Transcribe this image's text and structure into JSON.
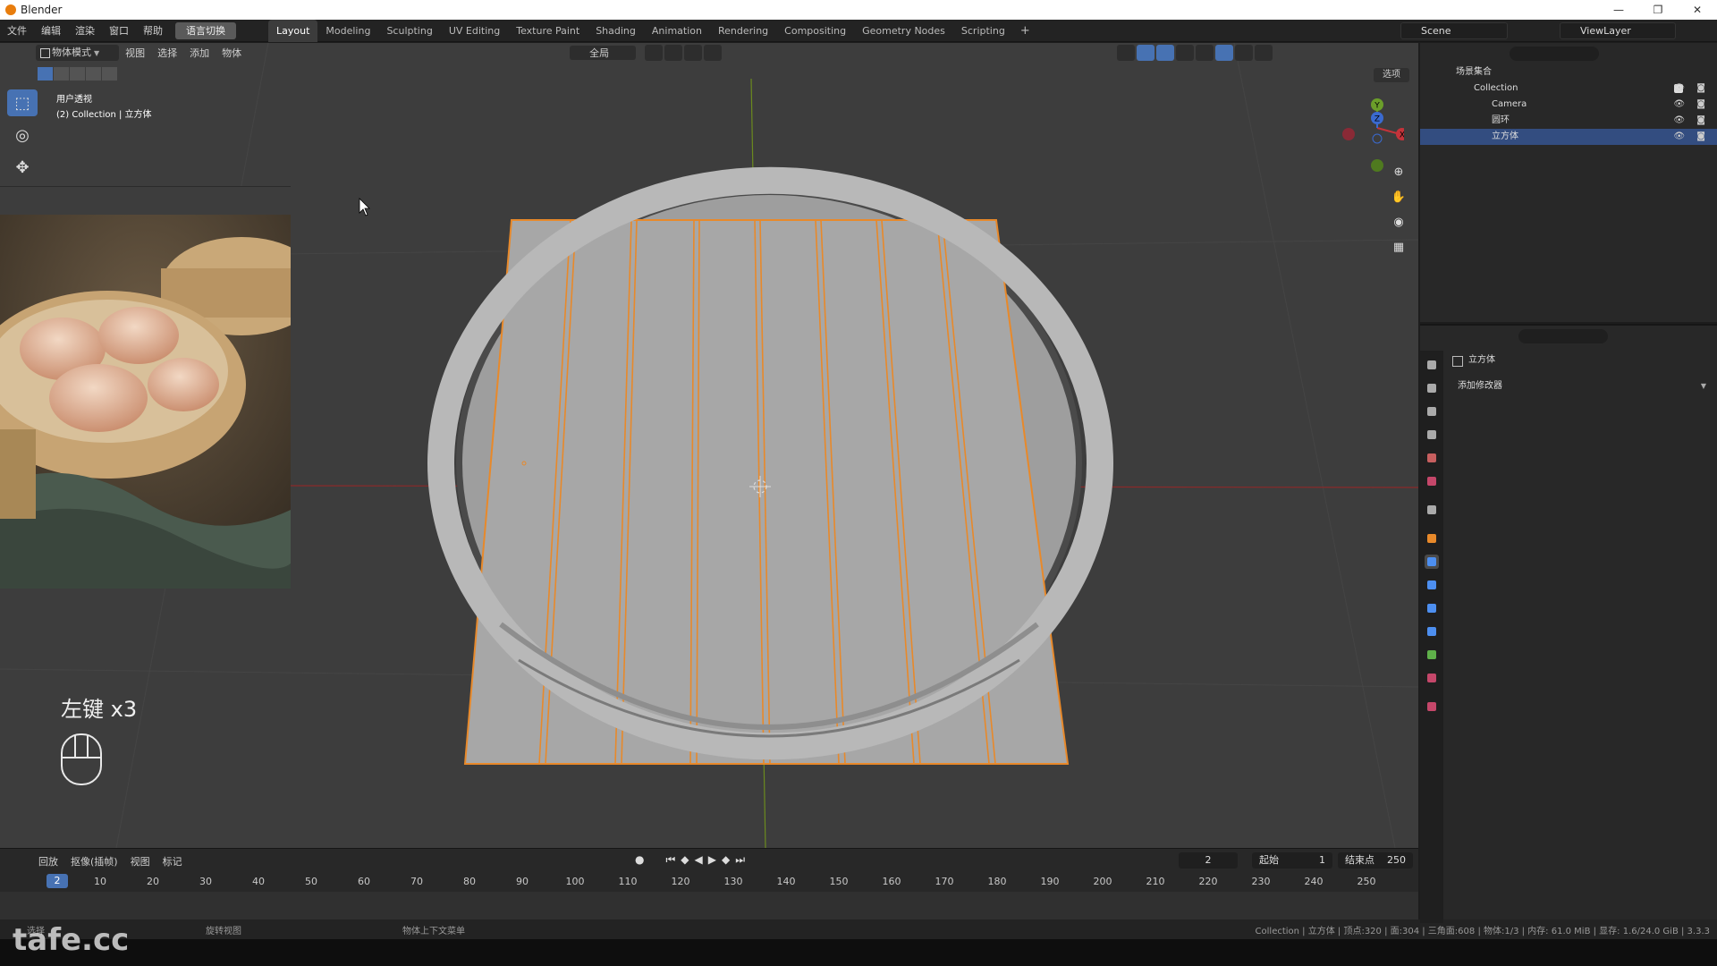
{
  "titlebar": {
    "title": "Blender",
    "minimize": "—",
    "maximize": "❐",
    "close": "✕"
  },
  "menu": {
    "items": [
      "文件",
      "编辑",
      "渲染",
      "窗口",
      "帮助"
    ],
    "lang_button": "语言切换",
    "workspaces": [
      "Layout",
      "Modeling",
      "Sculpting",
      "UV Editing",
      "Texture Paint",
      "Shading",
      "Animation",
      "Rendering",
      "Compositing",
      "Geometry Nodes",
      "Scripting"
    ],
    "add": "+",
    "scene": "Scene",
    "view_layer": "ViewLayer"
  },
  "viewport": {
    "mode": "物体模式",
    "header_menus": [
      "视图",
      "选择",
      "添加",
      "物体"
    ],
    "transform_orientation": "全局",
    "options": "选项",
    "info_line1": "用户透视",
    "info_line2": "(2) Collection | 立方体",
    "key_hint": "左键 x3",
    "gizmo": {
      "x": "X",
      "y": "Y",
      "z": "Z"
    }
  },
  "timeline": {
    "menus": [
      "回放",
      "抠像(插帧)",
      "视图",
      "标记"
    ],
    "current_frame": "2",
    "start_label": "起始",
    "start": "1",
    "end_label": "结束点",
    "end": "250",
    "ticks": [
      "10",
      "20",
      "30",
      "40",
      "50",
      "60",
      "70",
      "80",
      "90",
      "100",
      "110",
      "120",
      "130",
      "140",
      "150",
      "160",
      "170",
      "180",
      "190",
      "200",
      "210",
      "220",
      "230",
      "240",
      "250"
    ]
  },
  "statusbar": {
    "left": "选择",
    "middle1": "旋转视图",
    "middle2": "物体上下文菜单",
    "right": "Collection | 立方体 | 顶点:320 | 面:304 | 三角面:608 | 物体:1/3 | 内存: 61.0 MiB | 显存: 1.6/24.0 GiB | 3.3.3"
  },
  "watermark": "tafe.cc",
  "outliner": {
    "root": "场景集合",
    "collection": "Collection",
    "items": [
      "Camera",
      "圆环",
      "立方体"
    ]
  },
  "properties": {
    "object_name": "立方体",
    "add_modifier": "添加修改器"
  },
  "colors": {
    "accent": "#4772b3",
    "selection_orange": "#e8892a",
    "viewport_bg": "#3d3d3d",
    "axis_red": "#8a2a2a",
    "axis_green": "#6b8a1e"
  }
}
